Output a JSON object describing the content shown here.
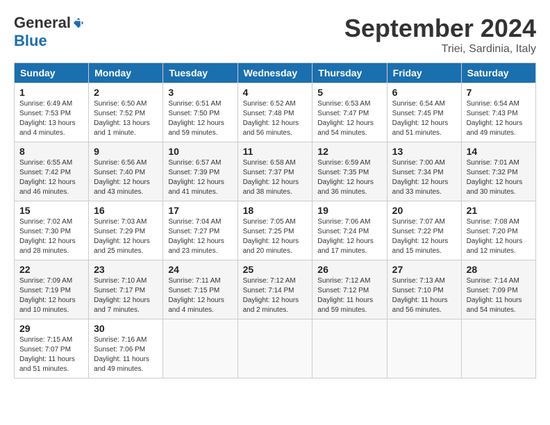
{
  "logo": {
    "general": "General",
    "blue": "Blue"
  },
  "title": "September 2024",
  "subtitle": "Triei, Sardinia, Italy",
  "days_header": [
    "Sunday",
    "Monday",
    "Tuesday",
    "Wednesday",
    "Thursday",
    "Friday",
    "Saturday"
  ],
  "weeks": [
    [
      {
        "day": "1",
        "info": "Sunrise: 6:49 AM\nSunset: 7:53 PM\nDaylight: 13 hours\nand 4 minutes."
      },
      {
        "day": "2",
        "info": "Sunrise: 6:50 AM\nSunset: 7:52 PM\nDaylight: 13 hours\nand 1 minute."
      },
      {
        "day": "3",
        "info": "Sunrise: 6:51 AM\nSunset: 7:50 PM\nDaylight: 12 hours\nand 59 minutes."
      },
      {
        "day": "4",
        "info": "Sunrise: 6:52 AM\nSunset: 7:48 PM\nDaylight: 12 hours\nand 56 minutes."
      },
      {
        "day": "5",
        "info": "Sunrise: 6:53 AM\nSunset: 7:47 PM\nDaylight: 12 hours\nand 54 minutes."
      },
      {
        "day": "6",
        "info": "Sunrise: 6:54 AM\nSunset: 7:45 PM\nDaylight: 12 hours\nand 51 minutes."
      },
      {
        "day": "7",
        "info": "Sunrise: 6:54 AM\nSunset: 7:43 PM\nDaylight: 12 hours\nand 49 minutes."
      }
    ],
    [
      {
        "day": "8",
        "info": "Sunrise: 6:55 AM\nSunset: 7:42 PM\nDaylight: 12 hours\nand 46 minutes."
      },
      {
        "day": "9",
        "info": "Sunrise: 6:56 AM\nSunset: 7:40 PM\nDaylight: 12 hours\nand 43 minutes."
      },
      {
        "day": "10",
        "info": "Sunrise: 6:57 AM\nSunset: 7:39 PM\nDaylight: 12 hours\nand 41 minutes."
      },
      {
        "day": "11",
        "info": "Sunrise: 6:58 AM\nSunset: 7:37 PM\nDaylight: 12 hours\nand 38 minutes."
      },
      {
        "day": "12",
        "info": "Sunrise: 6:59 AM\nSunset: 7:35 PM\nDaylight: 12 hours\nand 36 minutes."
      },
      {
        "day": "13",
        "info": "Sunrise: 7:00 AM\nSunset: 7:34 PM\nDaylight: 12 hours\nand 33 minutes."
      },
      {
        "day": "14",
        "info": "Sunrise: 7:01 AM\nSunset: 7:32 PM\nDaylight: 12 hours\nand 30 minutes."
      }
    ],
    [
      {
        "day": "15",
        "info": "Sunrise: 7:02 AM\nSunset: 7:30 PM\nDaylight: 12 hours\nand 28 minutes."
      },
      {
        "day": "16",
        "info": "Sunrise: 7:03 AM\nSunset: 7:29 PM\nDaylight: 12 hours\nand 25 minutes."
      },
      {
        "day": "17",
        "info": "Sunrise: 7:04 AM\nSunset: 7:27 PM\nDaylight: 12 hours\nand 23 minutes."
      },
      {
        "day": "18",
        "info": "Sunrise: 7:05 AM\nSunset: 7:25 PM\nDaylight: 12 hours\nand 20 minutes."
      },
      {
        "day": "19",
        "info": "Sunrise: 7:06 AM\nSunset: 7:24 PM\nDaylight: 12 hours\nand 17 minutes."
      },
      {
        "day": "20",
        "info": "Sunrise: 7:07 AM\nSunset: 7:22 PM\nDaylight: 12 hours\nand 15 minutes."
      },
      {
        "day": "21",
        "info": "Sunrise: 7:08 AM\nSunset: 7:20 PM\nDaylight: 12 hours\nand 12 minutes."
      }
    ],
    [
      {
        "day": "22",
        "info": "Sunrise: 7:09 AM\nSunset: 7:19 PM\nDaylight: 12 hours\nand 10 minutes."
      },
      {
        "day": "23",
        "info": "Sunrise: 7:10 AM\nSunset: 7:17 PM\nDaylight: 12 hours\nand 7 minutes."
      },
      {
        "day": "24",
        "info": "Sunrise: 7:11 AM\nSunset: 7:15 PM\nDaylight: 12 hours\nand 4 minutes."
      },
      {
        "day": "25",
        "info": "Sunrise: 7:12 AM\nSunset: 7:14 PM\nDaylight: 12 hours\nand 2 minutes."
      },
      {
        "day": "26",
        "info": "Sunrise: 7:12 AM\nSunset: 7:12 PM\nDaylight: 11 hours\nand 59 minutes."
      },
      {
        "day": "27",
        "info": "Sunrise: 7:13 AM\nSunset: 7:10 PM\nDaylight: 11 hours\nand 56 minutes."
      },
      {
        "day": "28",
        "info": "Sunrise: 7:14 AM\nSunset: 7:09 PM\nDaylight: 11 hours\nand 54 minutes."
      }
    ],
    [
      {
        "day": "29",
        "info": "Sunrise: 7:15 AM\nSunset: 7:07 PM\nDaylight: 11 hours\nand 51 minutes."
      },
      {
        "day": "30",
        "info": "Sunrise: 7:16 AM\nSunset: 7:06 PM\nDaylight: 11 hours\nand 49 minutes."
      },
      {
        "day": "",
        "info": ""
      },
      {
        "day": "",
        "info": ""
      },
      {
        "day": "",
        "info": ""
      },
      {
        "day": "",
        "info": ""
      },
      {
        "day": "",
        "info": ""
      }
    ]
  ]
}
